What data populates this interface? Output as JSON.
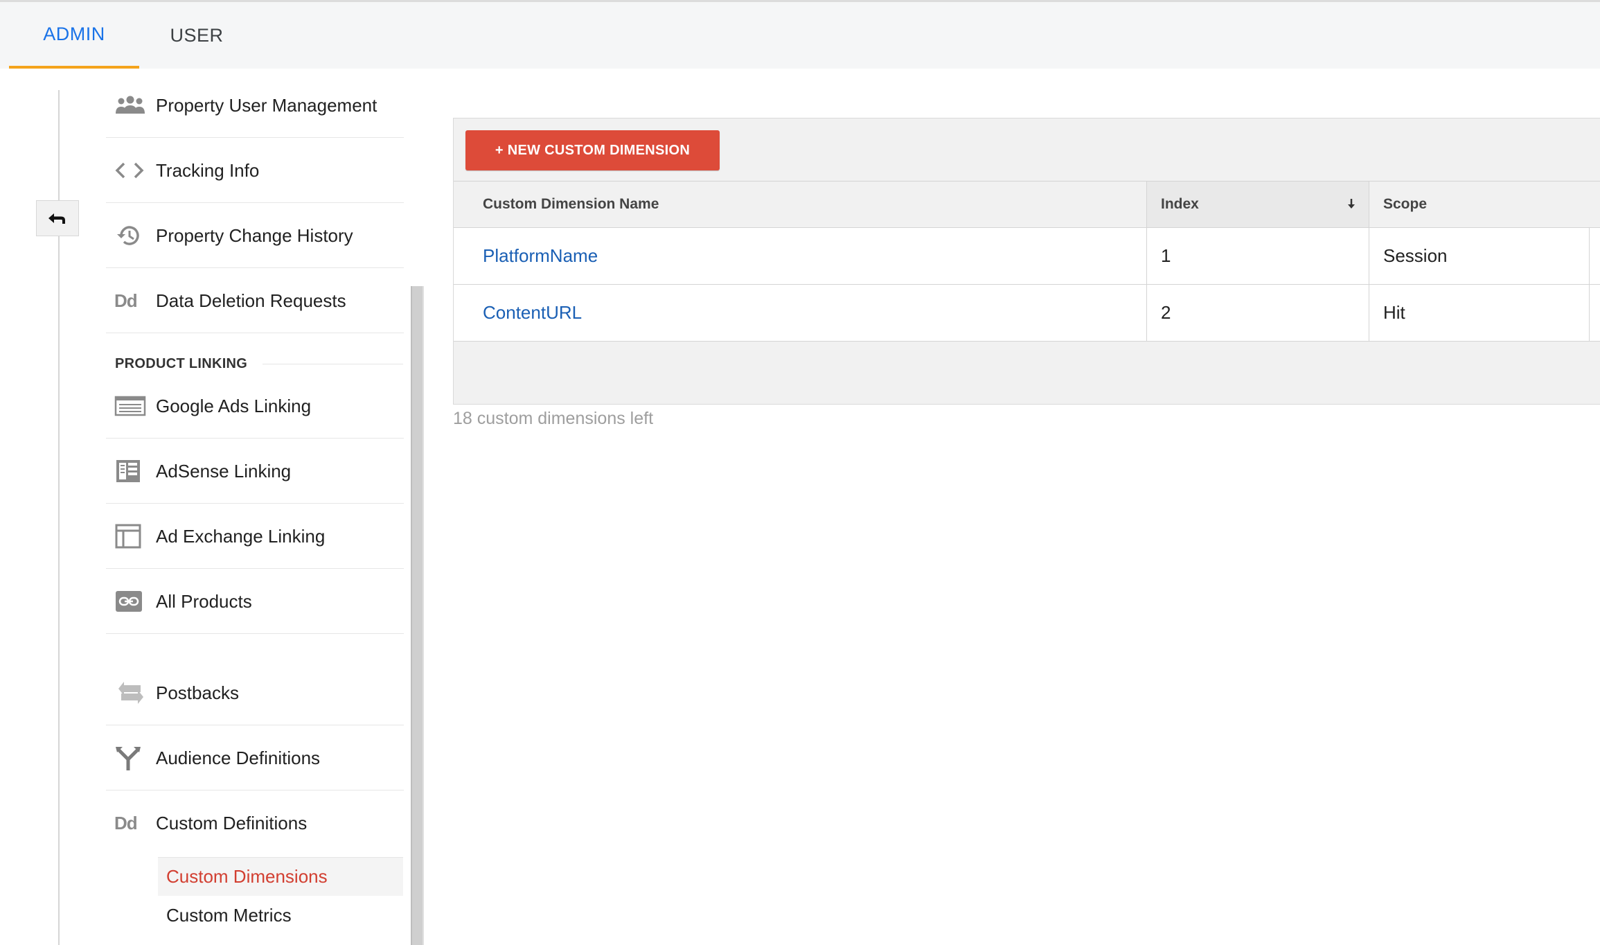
{
  "tabs": {
    "admin": "ADMIN",
    "user": "USER"
  },
  "sidebar": {
    "items_top": [
      {
        "label": "Property User Management",
        "icon": "users-icon"
      },
      {
        "label": "Tracking Info",
        "icon": "code-icon"
      },
      {
        "label": "Property Change History",
        "icon": "history-icon"
      },
      {
        "label": "Data Deletion Requests",
        "icon": "dd-icon",
        "icon_text": "Dd"
      }
    ],
    "section_title": "PRODUCT LINKING",
    "items_linking": [
      {
        "label": "Google Ads Linking",
        "icon": "ads-icon"
      },
      {
        "label": "AdSense Linking",
        "icon": "adsense-icon"
      },
      {
        "label": "Ad Exchange Linking",
        "icon": "adexchange-icon"
      },
      {
        "label": "All Products",
        "icon": "link-icon"
      }
    ],
    "items_bottom": [
      {
        "label": "Postbacks",
        "icon": "postbacks-icon"
      },
      {
        "label": "Audience Definitions",
        "icon": "audience-icon"
      },
      {
        "label": "Custom Definitions",
        "icon": "dd-icon",
        "icon_text": "Dd"
      }
    ],
    "sub_items": [
      {
        "label": "Custom Dimensions",
        "active": true
      },
      {
        "label": "Custom Metrics",
        "active": false
      }
    ]
  },
  "main": {
    "new_button_label": "+ NEW CUSTOM DIMENSION",
    "table": {
      "headers": [
        "Custom Dimension Name",
        "Index",
        "Scope"
      ],
      "sorted_column": "Index",
      "rows": [
        {
          "name": "PlatformName",
          "index": "1",
          "scope": "Session"
        },
        {
          "name": "ContentURL",
          "index": "2",
          "scope": "Hit"
        }
      ]
    },
    "remaining_text": "18 custom dimensions left"
  },
  "colors": {
    "accent_blue": "#1a73e8",
    "tab_underline": "#f4a31c",
    "button_red": "#dd4b39",
    "active_sub_red": "#d23f31",
    "link_blue": "#1a5fb4"
  }
}
